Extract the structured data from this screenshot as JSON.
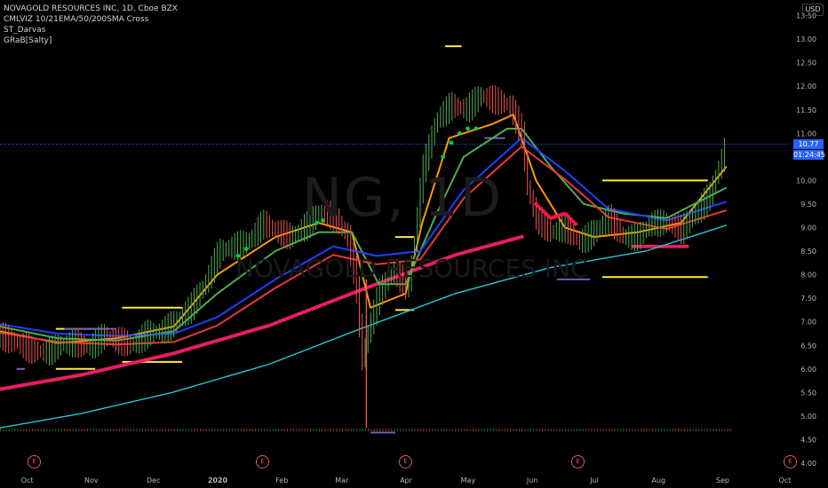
{
  "legend": {
    "title": "NOVAGOLD RESOURCES INC, 1D, Cboe BZX",
    "ind1": "CMLVIZ 10/21EMA/50/200SMA Cross",
    "ind2": "ST_Darvas",
    "ind3": "GRaB[Salty]"
  },
  "watermark": {
    "symbol": "NG, 1D",
    "name": "NOVAGOLD RESOURCES INC"
  },
  "currency": "USD",
  "last_price": {
    "label": "10.77",
    "countdown": "01:24:45",
    "color": "#2962ff"
  },
  "earnings_marker": "E",
  "colors": {
    "background": "#000000",
    "up": "#26a69a",
    "down": "#ef5350",
    "ema10": "#ff9800",
    "ema21": "#4caf50",
    "sma50": "#1e40ff",
    "sma200": "#26c6da",
    "grab_hi": "#00c853",
    "grab_lo": "#ff1744",
    "darvas_top": "#ffeb3b",
    "darvas_bottom": "#7e57c2"
  },
  "chart_data": {
    "type": "candlestick",
    "title": "NOVAGOLD RESOURCES INC, 1D, Cboe BZX",
    "xlabel": "",
    "ylabel": "",
    "x_ticks": [
      "Oct",
      "Nov",
      "Dec",
      "2020",
      "Feb",
      "Mar",
      "Apr",
      "May",
      "Jun",
      "Jul",
      "Aug",
      "Sep",
      "Oct"
    ],
    "y_ticks": [
      "4.00",
      "4.50",
      "5.00",
      "5.50",
      "6.00",
      "6.50",
      "7.00",
      "7.50",
      "8.00",
      "8.50",
      "9.00",
      "9.50",
      "10.00",
      "10.50",
      "11.00",
      "11.50",
      "12.00",
      "12.50",
      "13.00",
      "13.50"
    ],
    "ylim": [
      4.0,
      13.5
    ],
    "xlim": [
      "2019-09-23",
      "2020-10-09"
    ],
    "grid": false,
    "last_price": 10.77,
    "price_path": [
      [
        "2019-09-23",
        6.7
      ],
      [
        "2019-10-01",
        6.55
      ],
      [
        "2019-10-08",
        6.4
      ],
      [
        "2019-10-15",
        6.35
      ],
      [
        "2019-10-22",
        6.5
      ],
      [
        "2019-10-29",
        6.55
      ],
      [
        "2019-11-05",
        6.45
      ],
      [
        "2019-11-12",
        6.7
      ],
      [
        "2019-11-19",
        6.6
      ],
      [
        "2019-11-26",
        6.5
      ],
      [
        "2019-12-03",
        6.75
      ],
      [
        "2019-12-10",
        6.8
      ],
      [
        "2019-12-17",
        7.0
      ],
      [
        "2019-12-24",
        7.3
      ],
      [
        "2019-12-31",
        7.8
      ],
      [
        "2020-01-07",
        8.5
      ],
      [
        "2020-01-14",
        8.6
      ],
      [
        "2020-01-21",
        8.7
      ],
      [
        "2020-01-28",
        9.1
      ],
      [
        "2020-02-04",
        8.9
      ],
      [
        "2020-02-11",
        8.8
      ],
      [
        "2020-02-18",
        9.05
      ],
      [
        "2020-02-25",
        9.35
      ],
      [
        "2020-03-03",
        9.2
      ],
      [
        "2020-03-09",
        8.8
      ],
      [
        "2020-03-13",
        7.8
      ],
      [
        "2020-03-16",
        6.2
      ],
      [
        "2020-03-19",
        6.8
      ],
      [
        "2020-03-24",
        7.6
      ],
      [
        "2020-03-31",
        8.1
      ],
      [
        "2020-04-07",
        7.7
      ],
      [
        "2020-04-10",
        8.6
      ],
      [
        "2020-04-14",
        10.2
      ],
      [
        "2020-04-21",
        11.3
      ],
      [
        "2020-04-28",
        11.6
      ],
      [
        "2020-05-05",
        11.5
      ],
      [
        "2020-05-12",
        11.8
      ],
      [
        "2020-05-19",
        11.7
      ],
      [
        "2020-05-26",
        11.6
      ],
      [
        "2020-06-01",
        11.0
      ],
      [
        "2020-06-04",
        9.8
      ],
      [
        "2020-06-08",
        9.2
      ],
      [
        "2020-06-15",
        8.9
      ],
      [
        "2020-06-22",
        9.0
      ],
      [
        "2020-06-29",
        8.7
      ],
      [
        "2020-07-06",
        8.9
      ],
      [
        "2020-07-13",
        9.2
      ],
      [
        "2020-07-20",
        8.8
      ],
      [
        "2020-07-27",
        8.8
      ],
      [
        "2020-08-03",
        9.1
      ],
      [
        "2020-08-10",
        9.1
      ],
      [
        "2020-08-17",
        8.95
      ],
      [
        "2020-08-24",
        9.3
      ],
      [
        "2020-08-31",
        9.7
      ],
      [
        "2020-09-08",
        10.77
      ]
    ],
    "series": [
      {
        "name": "10 EMA",
        "color": "#ff9800",
        "points": [
          [
            "2019-09-23",
            6.8
          ],
          [
            "2019-10-21",
            6.55
          ],
          [
            "2019-11-18",
            6.65
          ],
          [
            "2019-12-16",
            6.9
          ],
          [
            "2020-01-06",
            8.0
          ],
          [
            "2020-02-03",
            8.8
          ],
          [
            "2020-02-24",
            9.1
          ],
          [
            "2020-03-11",
            8.9
          ],
          [
            "2020-03-20",
            7.3
          ],
          [
            "2020-04-06",
            7.6
          ],
          [
            "2020-04-14",
            9.1
          ],
          [
            "2020-04-27",
            10.9
          ],
          [
            "2020-05-18",
            11.2
          ],
          [
            "2020-05-28",
            11.4
          ],
          [
            "2020-06-08",
            10.0
          ],
          [
            "2020-06-22",
            9.0
          ],
          [
            "2020-07-06",
            8.8
          ],
          [
            "2020-07-27",
            8.9
          ],
          [
            "2020-08-17",
            9.1
          ],
          [
            "2020-09-08",
            10.3
          ]
        ]
      },
      {
        "name": "21 EMA",
        "color": "#4caf50",
        "points": [
          [
            "2019-09-23",
            6.9
          ],
          [
            "2019-10-21",
            6.65
          ],
          [
            "2019-11-18",
            6.6
          ],
          [
            "2019-12-16",
            6.8
          ],
          [
            "2020-01-06",
            7.6
          ],
          [
            "2020-02-03",
            8.5
          ],
          [
            "2020-02-24",
            8.9
          ],
          [
            "2020-03-11",
            8.9
          ],
          [
            "2020-03-24",
            7.8
          ],
          [
            "2020-04-06",
            7.8
          ],
          [
            "2020-04-21",
            9.3
          ],
          [
            "2020-05-04",
            10.5
          ],
          [
            "2020-05-25",
            11.1
          ],
          [
            "2020-06-01",
            11.1
          ],
          [
            "2020-06-15",
            10.3
          ],
          [
            "2020-07-01",
            9.5
          ],
          [
            "2020-07-20",
            9.3
          ],
          [
            "2020-08-10",
            9.2
          ],
          [
            "2020-09-08",
            9.85
          ]
        ]
      },
      {
        "name": "50 SMA",
        "color": "#1e40ff",
        "points": [
          [
            "2019-09-23",
            6.95
          ],
          [
            "2019-10-21",
            6.75
          ],
          [
            "2019-11-18",
            6.7
          ],
          [
            "2019-12-16",
            6.75
          ],
          [
            "2020-01-06",
            7.1
          ],
          [
            "2020-02-03",
            7.9
          ],
          [
            "2020-03-02",
            8.6
          ],
          [
            "2020-03-23",
            8.4
          ],
          [
            "2020-04-13",
            8.5
          ],
          [
            "2020-05-04",
            9.8
          ],
          [
            "2020-06-01",
            10.9
          ],
          [
            "2020-06-22",
            10.2
          ],
          [
            "2020-07-13",
            9.4
          ],
          [
            "2020-08-10",
            9.15
          ],
          [
            "2020-09-08",
            9.55
          ]
        ]
      },
      {
        "name": "200 SMA",
        "color": "#26c6da",
        "points": [
          [
            "2019-09-23",
            4.75
          ],
          [
            "2019-11-01",
            5.05
          ],
          [
            "2019-12-15",
            5.5
          ],
          [
            "2020-01-31",
            6.1
          ],
          [
            "2020-03-15",
            6.85
          ],
          [
            "2020-04-30",
            7.6
          ],
          [
            "2020-06-15",
            8.15
          ],
          [
            "2020-07-31",
            8.5
          ],
          [
            "2020-09-08",
            9.05
          ]
        ]
      }
    ],
    "darvas_boxes": [
      {
        "top": 6.85,
        "bottom": 6.0,
        "start": "2019-10-20",
        "end": "2019-11-08"
      },
      {
        "top": 7.3,
        "bottom": 6.15,
        "start": "2019-11-21",
        "end": "2019-12-20"
      },
      {
        "top": 8.8,
        "bottom": 7.25,
        "start": "2020-04-01",
        "end": "2020-04-10"
      },
      {
        "top": 10.0,
        "bottom": 7.95,
        "start": "2020-07-10",
        "end": "2020-08-30"
      }
    ]
  }
}
